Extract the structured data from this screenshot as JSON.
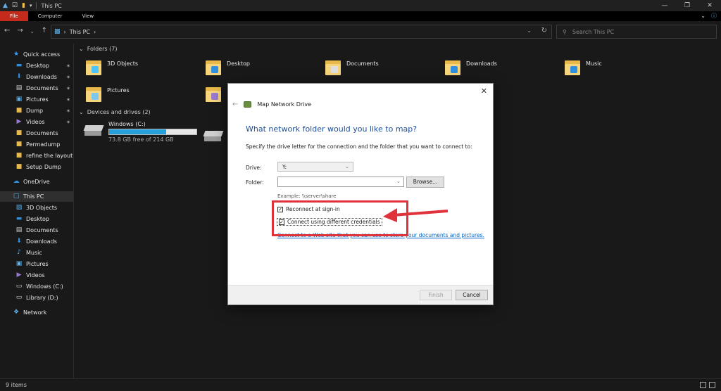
{
  "titlebar": {
    "title": "This PC",
    "qa_icons": [
      "explorer-icon",
      "properties-icon",
      "new-folder-icon",
      "customize-icon"
    ]
  },
  "ribbon": {
    "tabs": [
      "File",
      "Computer",
      "View"
    ]
  },
  "address": {
    "path": "This PC",
    "search_placeholder": "Search This PC"
  },
  "sidebar": {
    "items": [
      {
        "label": "Quick access",
        "icon": "star-icon",
        "color": "#3aa0ff",
        "pinned": false
      },
      {
        "label": "Desktop",
        "icon": "desktop-icon",
        "color": "#2f8fe0",
        "pinned": true
      },
      {
        "label": "Downloads",
        "icon": "download-icon",
        "color": "#2f8fe0",
        "pinned": true
      },
      {
        "label": "Documents",
        "icon": "document-icon",
        "color": "#cfcfcf",
        "pinned": true
      },
      {
        "label": "Pictures",
        "icon": "picture-icon",
        "color": "#5fb0e8",
        "pinned": true
      },
      {
        "label": "Dump",
        "icon": "folder-icon",
        "color": "#e8b84a",
        "pinned": true
      },
      {
        "label": "Videos",
        "icon": "video-icon",
        "color": "#9a7ad0",
        "pinned": true
      },
      {
        "label": "Documents",
        "icon": "folder-icon",
        "color": "#e8b84a",
        "pinned": false
      },
      {
        "label": "Permadump",
        "icon": "folder-icon",
        "color": "#e8b84a",
        "pinned": false
      },
      {
        "label": "refine the layout",
        "icon": "folder-icon",
        "color": "#e8b84a",
        "pinned": false
      },
      {
        "label": "Setup Dump",
        "icon": "folder-icon",
        "color": "#e8b84a",
        "pinned": false
      },
      {
        "label": "OneDrive",
        "icon": "cloud-icon",
        "color": "#2f8fe0",
        "pinned": false
      },
      {
        "label": "This PC",
        "icon": "computer-icon",
        "color": "#5fb0e8",
        "pinned": false
      },
      {
        "label": "3D Objects",
        "icon": "cube-icon",
        "color": "#5fb0e8",
        "pinned": false
      },
      {
        "label": "Desktop",
        "icon": "desktop-icon",
        "color": "#2f8fe0",
        "pinned": false
      },
      {
        "label": "Documents",
        "icon": "document-icon",
        "color": "#cfcfcf",
        "pinned": false
      },
      {
        "label": "Downloads",
        "icon": "download-icon",
        "color": "#2f8fe0",
        "pinned": false
      },
      {
        "label": "Music",
        "icon": "music-icon",
        "color": "#5fb0e8",
        "pinned": false
      },
      {
        "label": "Pictures",
        "icon": "picture-icon",
        "color": "#5fb0e8",
        "pinned": false
      },
      {
        "label": "Videos",
        "icon": "video-icon",
        "color": "#9a7ad0",
        "pinned": false
      },
      {
        "label": "Windows (C:)",
        "icon": "drive-icon",
        "color": "#cfcfcf",
        "pinned": false
      },
      {
        "label": "Library (D:)",
        "icon": "drive-icon",
        "color": "#cfcfcf",
        "pinned": false
      },
      {
        "label": "Network",
        "icon": "network-icon",
        "color": "#5fb0e8",
        "pinned": false
      }
    ],
    "selected": "This PC"
  },
  "content": {
    "folders_header": "Folders (7)",
    "folders": [
      {
        "label": "3D Objects",
        "badge": "#4fc3f7"
      },
      {
        "label": "Desktop",
        "badge": "#2f8fe0"
      },
      {
        "label": "Documents",
        "badge": "#e0e0e0"
      },
      {
        "label": "Downloads",
        "badge": "#2f8fe0"
      },
      {
        "label": "Music",
        "badge": "#2f8fe0"
      },
      {
        "label": "Pictures",
        "badge": "#7ec8f0"
      },
      {
        "label": "",
        "badge": "#9a7ad0"
      }
    ],
    "drives_header": "Devices and drives (2)",
    "drives": [
      {
        "label": "Windows (C:)",
        "free_text": "73.8 GB free of 214 GB",
        "used_fraction": 0.655
      },
      {
        "label": "",
        "free_text": "",
        "used_fraction": 0
      }
    ]
  },
  "status": {
    "items": "9 items"
  },
  "dialog": {
    "title": "Map Network Drive",
    "question": "What network folder would you like to map?",
    "description": "Specify the drive letter for the connection and the folder that you want to connect to:",
    "drive_label": "Drive:",
    "drive_value": "Y:",
    "folder_label": "Folder:",
    "folder_value": "",
    "browse_label": "Browse...",
    "example": "Example: \\\\server\\share",
    "reconnect_label": "Reconnect at sign-in",
    "reconnect_checked": true,
    "credentials_label": "Connect using different credentials",
    "credentials_checked": true,
    "link_text": "Connect to a Web site that you can use to store your documents and pictures.",
    "finish_label": "Finish",
    "cancel_label": "Cancel"
  },
  "annotation": {
    "color": "#e0323a"
  }
}
